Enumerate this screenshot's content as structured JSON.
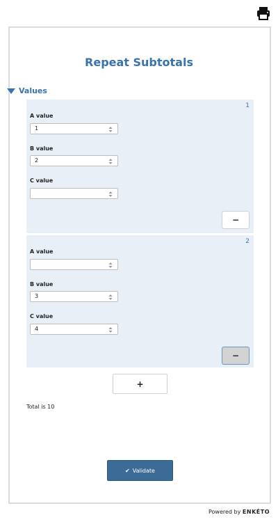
{
  "form": {
    "title": "Repeat Subtotals",
    "group_label": "Values"
  },
  "repeats": [
    {
      "index": "1",
      "fields": [
        {
          "label": "A value",
          "value": "1"
        },
        {
          "label": "B value",
          "value": "2"
        },
        {
          "label": "C value",
          "value": ""
        }
      ],
      "remove_label": "−"
    },
    {
      "index": "2",
      "fields": [
        {
          "label": "A value",
          "value": ""
        },
        {
          "label": "B value",
          "value": "3"
        },
        {
          "label": "C value",
          "value": "4"
        }
      ],
      "remove_label": "−"
    }
  ],
  "add_label": "+",
  "total_note": "Total is 10",
  "validate_label": "Validate",
  "footer": {
    "powered_by": "Powered by",
    "brand": "ENKÉTO"
  },
  "colors": {
    "accent": "#3973ad",
    "repeat_bg": "#e8eff6",
    "validate_bg": "#3d6b98"
  },
  "icons": [
    "print-icon",
    "caret-down-icon",
    "spinner-icon",
    "check-icon"
  ]
}
